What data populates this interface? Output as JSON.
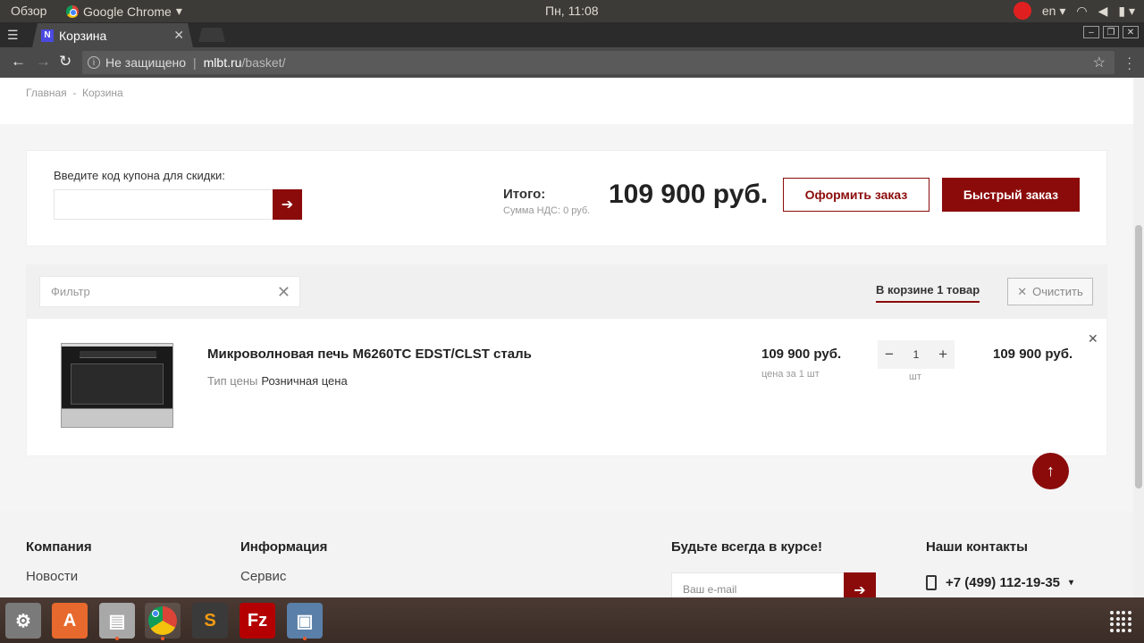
{
  "os": {
    "activities": "Обзор",
    "app_name": "Google Chrome",
    "clock": "Пн, 11:08",
    "lang": "en"
  },
  "browser": {
    "tab_title": "Корзина",
    "tab_favicon": "N",
    "security_text": "Не защищено",
    "url_host": "mlbt.ru",
    "url_path": "/basket/"
  },
  "breadcrumb": "Главная  -  Корзина",
  "coupon": {
    "label": "Введите код купона для скидки:",
    "value": ""
  },
  "summary": {
    "total_label": "Итого:",
    "vat": "Сумма НДС: 0 руб.",
    "total": "109 900 руб.",
    "order_btn": "Оформить заказ",
    "quick_btn": "Быстрый заказ"
  },
  "list": {
    "filter_placeholder": "Фильтр",
    "count_label": "В корзине 1 товар",
    "clear_label": "Очистить"
  },
  "items": [
    {
      "title": "Микроволновая печь M6260TC EDST/CLST сталь",
      "price_type_label": "Тип цены",
      "price_type": "Розничная цена",
      "unit_price": "109 900 руб.",
      "unit_sub": "цена за 1 шт",
      "qty": "1",
      "qty_unit": "шт",
      "total": "109 900 руб."
    }
  ],
  "footer": {
    "col1_title": "Компания",
    "col1_link": "Новости",
    "col2_title": "Информация",
    "col2_link": "Сервис",
    "subscribe_title": "Будьте всегда в курсе!",
    "email_placeholder": "Ваш e-mail",
    "contacts_title": "Наши контакты",
    "phone": "+7 (499) 112-19-35"
  },
  "colors": {
    "accent": "#8b0b0b"
  }
}
